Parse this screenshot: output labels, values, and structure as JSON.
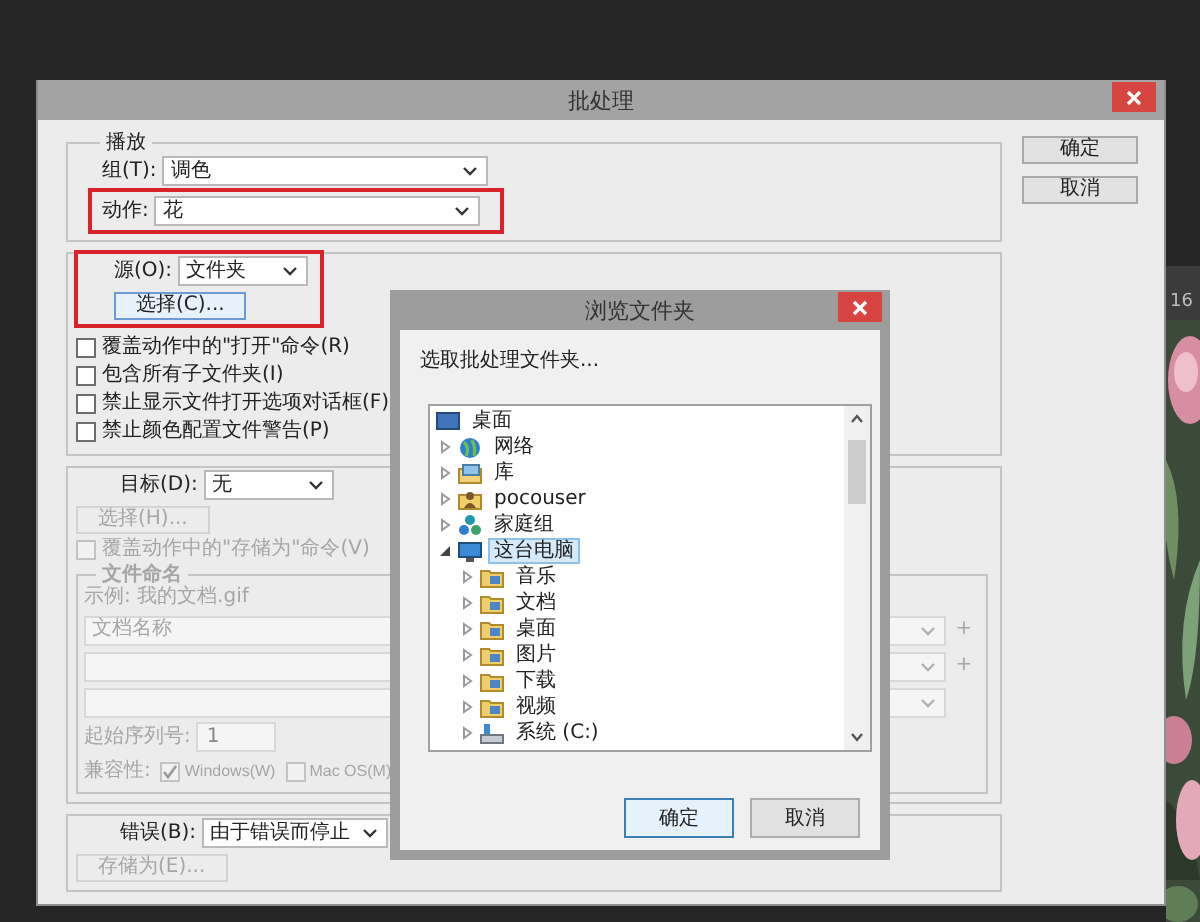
{
  "side_panel": {
    "tab_text": "16"
  },
  "batch_dialog": {
    "title": "批处理",
    "playback": {
      "legend": "播放",
      "fields": [
        {
          "label": "组(T):",
          "value": "调色",
          "highlighted": false
        },
        {
          "label": "动作:",
          "value": "花",
          "highlighted": true
        }
      ]
    },
    "source": {
      "label": "源(O):",
      "value": "文件夹",
      "highlighted": true,
      "choose_button": {
        "label": "选择(C)...",
        "disabled": false
      },
      "options": [
        {
          "label": "覆盖动作中的\"打开\"命令(R)",
          "checked": false,
          "disabled": false
        },
        {
          "label": "包含所有子文件夹(I)",
          "checked": false,
          "disabled": false
        },
        {
          "label": "禁止显示文件打开选项对话框(F)",
          "checked": false,
          "disabled": false
        },
        {
          "label": "禁止颜色配置文件警告(P)",
          "checked": false,
          "disabled": false
        }
      ]
    },
    "target": {
      "label": "目标(D):",
      "value": "无",
      "choose_button": {
        "label": "选择(H)...",
        "disabled": true
      },
      "override": {
        "label": "覆盖动作中的\"存储为\"命令(V)",
        "checked": false,
        "disabled": true
      },
      "file_naming": {
        "legend": "文件命名",
        "disabled": true,
        "example": "示例: 我的文档.gif",
        "name_rows": [
          {
            "kind": "combo",
            "value": "文档名称",
            "add_button": "+"
          },
          {
            "kind": "combo",
            "add_button": "+"
          },
          {
            "kind": "combo"
          }
        ],
        "start_serial": {
          "label": "起始序列号:",
          "value": "1"
        },
        "compatibility": {
          "label": "兼容性:",
          "options": [
            {
              "label": "Windows(W)",
              "checked": true,
              "disabled": true
            },
            {
              "label": "Mac OS(M)",
              "checked": false,
              "disabled": true
            }
          ]
        }
      }
    },
    "errors": {
      "label": "错误(B):",
      "value": "由于错误而停止",
      "save_button": {
        "label": "存储为(E)...",
        "disabled": true
      }
    },
    "buttons": [
      {
        "label": "确定"
      },
      {
        "label": "取消"
      }
    ]
  },
  "folder_dialog": {
    "title": "浏览文件夹",
    "prompt": "选取批处理文件夹...",
    "tree": [
      {
        "label": "桌面",
        "kind": "desktop",
        "selected": false,
        "children": [
          {
            "label": "网络",
            "kind": "network",
            "expanded": false,
            "selected": false
          },
          {
            "label": "库",
            "kind": "library",
            "expanded": false,
            "selected": false
          },
          {
            "label": "pocouser",
            "kind": "user",
            "expanded": false,
            "selected": false
          },
          {
            "label": "家庭组",
            "kind": "homegroup",
            "expanded": false,
            "selected": false
          },
          {
            "label": "这台电脑",
            "kind": "computer",
            "expanded": true,
            "selected": true,
            "children": [
              {
                "label": "音乐",
                "kind": "folder",
                "expanded": false,
                "selected": false
              },
              {
                "label": "文档",
                "kind": "folder",
                "expanded": false,
                "selected": false
              },
              {
                "label": "桌面",
                "kind": "folder",
                "expanded": false,
                "selected": false
              },
              {
                "label": "图片",
                "kind": "folder",
                "expanded": false,
                "selected": false
              },
              {
                "label": "下载",
                "kind": "folder",
                "expanded": false,
                "selected": false
              },
              {
                "label": "视频",
                "kind": "folder",
                "expanded": false,
                "selected": false
              },
              {
                "label": "系统 (C:)",
                "kind": "drive",
                "expanded": false,
                "selected": false
              }
            ]
          }
        ]
      }
    ],
    "buttons": [
      {
        "label": "确定",
        "default": true
      },
      {
        "label": "取消",
        "default": false
      }
    ]
  }
}
